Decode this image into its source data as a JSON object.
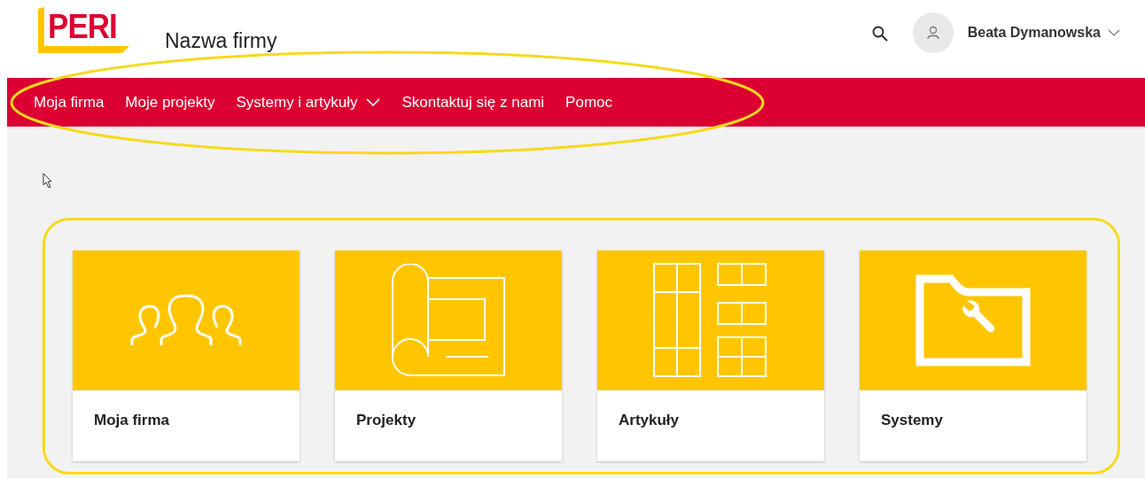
{
  "header": {
    "logo": "PERI",
    "company_name": "Nazwa firmy",
    "user_name": "Beata Dymanowska"
  },
  "nav": [
    {
      "label": "Moja firma",
      "has_menu": false
    },
    {
      "label": "Moje projekty",
      "has_menu": false
    },
    {
      "label": "Systemy i artykuły",
      "has_menu": true
    },
    {
      "label": "Skontaktuj się z nami",
      "has_menu": false
    },
    {
      "label": "Pomoc",
      "has_menu": false
    }
  ],
  "tiles": [
    {
      "kind": "people",
      "label": "Moja firma"
    },
    {
      "kind": "plan",
      "label": "Projekty"
    },
    {
      "kind": "grid",
      "label": "Artykuły"
    },
    {
      "kind": "folder",
      "label": "Systemy"
    }
  ]
}
